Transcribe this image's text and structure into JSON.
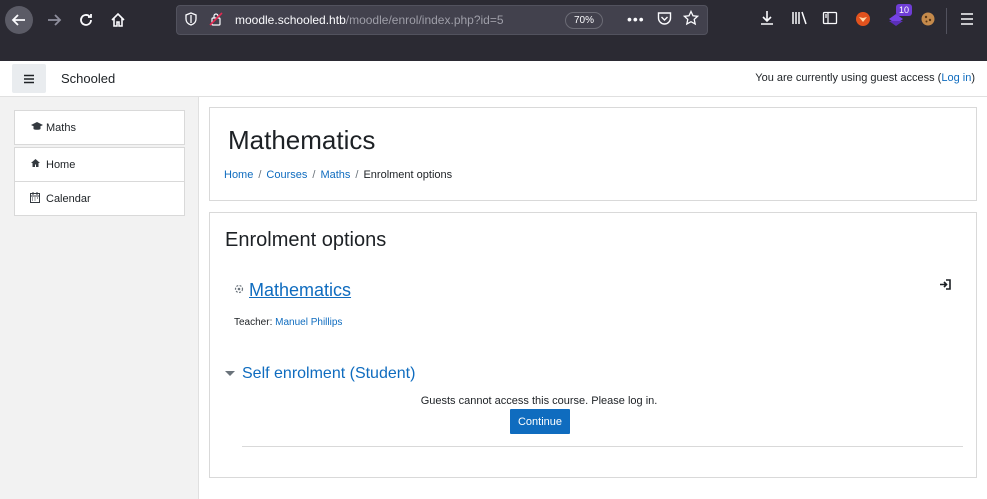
{
  "browser": {
    "url_host": "moodle.schooled.htb",
    "url_path": "/moodle/enrol/index.php?id=5",
    "zoom": "70%",
    "extension_badge": "10"
  },
  "navbar": {
    "site_name": "Schooled",
    "login_prefix": "You are currently using guest access (",
    "login_link": "Log in",
    "login_suffix": ")"
  },
  "drawer": {
    "items": [
      {
        "label": "Maths",
        "icon": "graduation-cap-icon"
      },
      {
        "label": "Home",
        "icon": "home-icon"
      },
      {
        "label": "Calendar",
        "icon": "calendar-icon"
      }
    ]
  },
  "header": {
    "title": "Mathematics",
    "breadcrumb": [
      "Home",
      "Courses",
      "Maths",
      "Enrolment options"
    ]
  },
  "content": {
    "heading": "Enrolment options",
    "course_name": "Mathematics",
    "teacher_label": "Teacher: ",
    "teacher_name": "Manuel Phillips",
    "self_enrol_title": "Self enrolment (Student)",
    "guest_message": "Guests cannot access this course. Please log in.",
    "continue_label": "Continue"
  },
  "colors": {
    "link": "#0f6cbf",
    "browser_chrome": "#2b2a33",
    "button_primary": "#0f6cbf"
  }
}
